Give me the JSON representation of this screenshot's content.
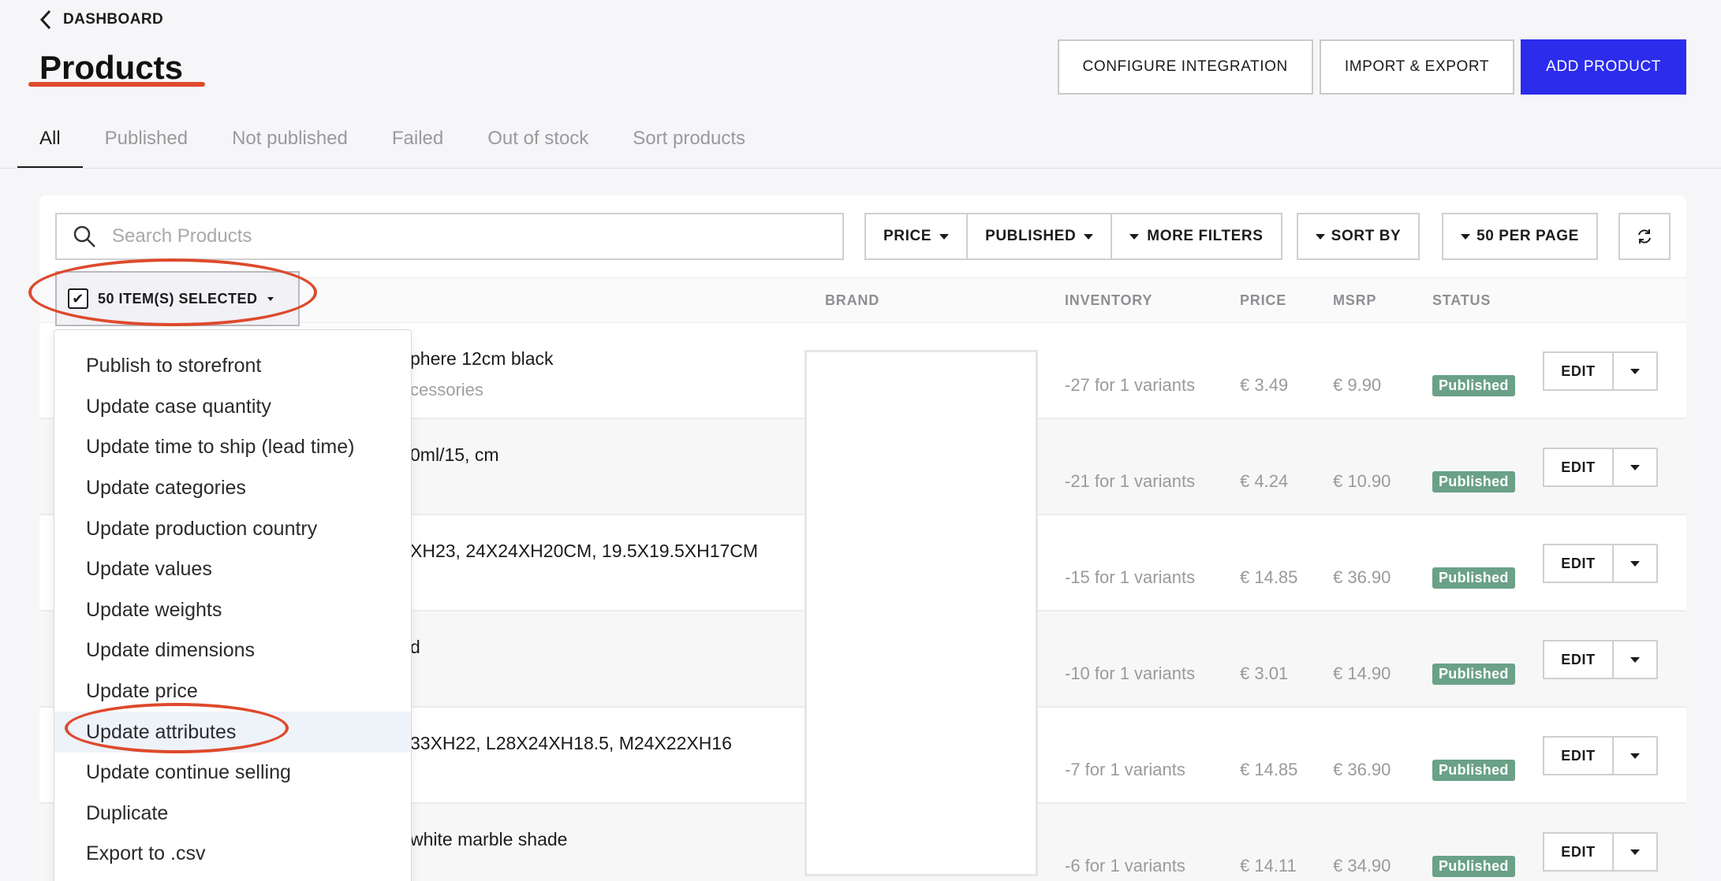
{
  "header": {
    "back_label": "DASHBOARD",
    "title": "Products",
    "actions": [
      "CONFIGURE INTEGRATION",
      "IMPORT & EXPORT",
      "ADD PRODUCT"
    ]
  },
  "tabs": [
    "All",
    "Published",
    "Not published",
    "Failed",
    "Out of stock",
    "Sort products"
  ],
  "toolbar": {
    "search_placeholder": "Search Products",
    "filters": [
      "PRICE",
      "PUBLISHED",
      "MORE FILTERS"
    ],
    "sort_label": "SORT BY",
    "per_page_label": "50 PER PAGE"
  },
  "selection": {
    "label": "50 ITEM(S) SELECTED"
  },
  "table": {
    "columns": [
      "BRAND",
      "INVENTORY",
      "PRICE",
      "MSRP",
      "STATUS"
    ],
    "rows": [
      {
        "name": "phere 12cm black",
        "sub": "cessories",
        "inventory": "-27 for 1 variants",
        "price": "€ 3.49",
        "msrp": "€ 9.90",
        "status": "Published"
      },
      {
        "name": "0ml/15, cm",
        "sub": "",
        "inventory": "-21 for 1 variants",
        "price": "€ 4.24",
        "msrp": "€ 10.90",
        "status": "Published"
      },
      {
        "name": "XH23, 24X24XH20CM, 19.5X19.5XH17CM",
        "sub": "",
        "inventory": "-15 for 1 variants",
        "price": "€ 14.85",
        "msrp": "€ 36.90",
        "status": "Published"
      },
      {
        "name": "d",
        "sub": "",
        "inventory": "-10 for 1 variants",
        "price": "€ 3.01",
        "msrp": "€ 14.90",
        "status": "Published"
      },
      {
        "name": "33XH22, L28X24XH18.5, M24X22XH16",
        "sub": "",
        "inventory": "-7 for 1 variants",
        "price": "€ 14.85",
        "msrp": "€ 36.90",
        "status": "Published"
      },
      {
        "name": "white marble shade",
        "sub": "",
        "inventory": "-6 for 1 variants",
        "price": "€ 14.11",
        "msrp": "€ 34.90",
        "status": "Published"
      }
    ],
    "edit_label": "EDIT"
  },
  "bulk_menu": [
    "Publish to storefront",
    "Update case quantity",
    "Update time to ship (lead time)",
    "Update categories",
    "Update production country",
    "Update values",
    "Update weights",
    "Update dimensions",
    "Update price",
    "Update attributes",
    "Update continue selling",
    "Duplicate",
    "Export to .csv"
  ],
  "colors": {
    "accent": "#2c2cec",
    "status_published": "#6aa187",
    "annotation": "#dd4a2c"
  }
}
